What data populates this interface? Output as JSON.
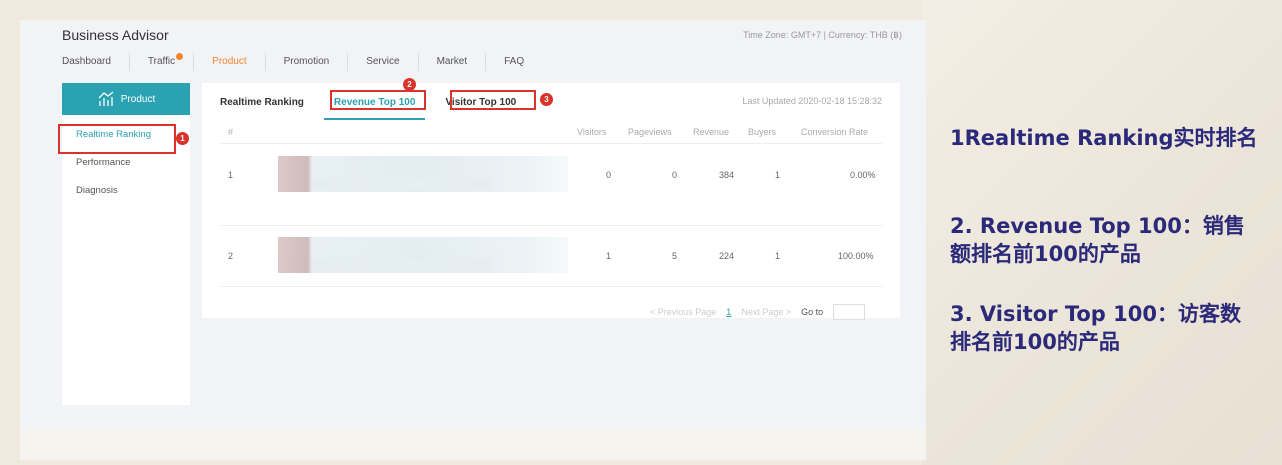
{
  "app": {
    "title": "Business Advisor",
    "timezone": "Time Zone: GMT+7 | Currency: THB (฿)"
  },
  "topnav": [
    {
      "label": "Dashboard",
      "active": false
    },
    {
      "label": "Traffic",
      "active": false,
      "dot": true
    },
    {
      "label": "Product",
      "active": true
    },
    {
      "label": "Promotion",
      "active": false
    },
    {
      "label": "Service",
      "active": false
    },
    {
      "label": "Market",
      "active": false
    },
    {
      "label": "FAQ",
      "active": false
    }
  ],
  "sidebar": {
    "header": "Product",
    "items": [
      "Realtime Ranking",
      "Performance",
      "Diagnosis"
    ]
  },
  "tabs": [
    "Realtime Ranking",
    "Revenue Top 100",
    "Visitor Top 100"
  ],
  "last_updated": "Last Updated 2020-02-18 15:28:32",
  "table": {
    "columns": [
      "#",
      "Visitors",
      "Pageviews",
      "Revenue",
      "Buyers",
      "Conversion Rate"
    ],
    "rows": [
      {
        "rank": "1",
        "visitors": "0",
        "pageviews": "0",
        "revenue": "384",
        "buyers": "1",
        "conversion": "0.00%"
      },
      {
        "rank": "2",
        "visitors": "1",
        "pageviews": "5",
        "revenue": "224",
        "buyers": "1",
        "conversion": "100.00%"
      }
    ]
  },
  "pager": {
    "prev": "< Previous Page",
    "current": "1",
    "next": "Next Page >",
    "goto": "Go to"
  },
  "markers": [
    "1",
    "2",
    "3"
  ],
  "notes": [
    "1Realtime Ranking实时排名",
    "2. Revenue Top 100：销售额排名前100的产品",
    "3. Visitor Top 100：访客数排名前100的产品"
  ],
  "colors": {
    "accent": "#2aa2b2",
    "active_nav": "#f5852d",
    "highlight": "#d9342b",
    "note_text": "#2b2a7a"
  }
}
